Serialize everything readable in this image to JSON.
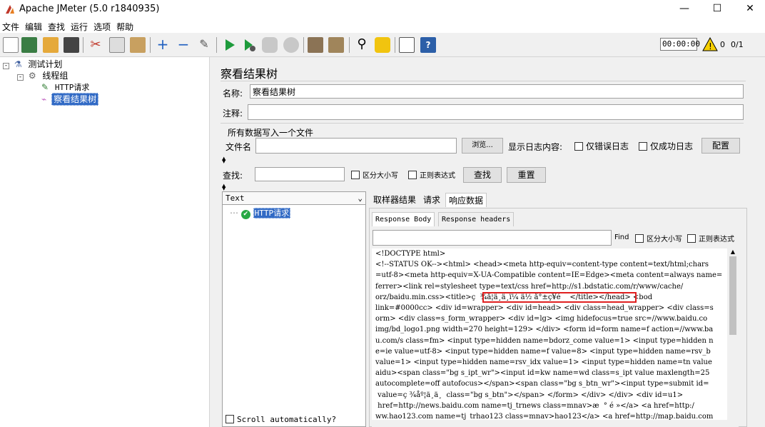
{
  "window": {
    "title": "Apache JMeter (5.0 r1840935)",
    "minimize": "—",
    "maximize": "☐",
    "close": "✕"
  },
  "menu": [
    "文件",
    "编辑",
    "查找",
    "运行",
    "选项",
    "帮助"
  ],
  "toolbar": {
    "icons": [
      "new-icon",
      "templates-icon",
      "open-icon",
      "save-icon",
      "cut-icon",
      "copy-icon",
      "paste-icon",
      "expand-icon",
      "collapse-icon",
      "toggle-icon",
      "start-icon",
      "start-no-pause-icon",
      "stop-icon",
      "shutdown-icon",
      "clear-icon",
      "clear-all-icon",
      "search-icon",
      "reset-search-icon",
      "function-helper-icon",
      "help-icon"
    ],
    "timer": "00:00:00",
    "warning_count": "0",
    "threads": "0/1"
  },
  "tree": {
    "root": "测试计划",
    "thread_group": "线程组",
    "http_request": "HTTP请求",
    "results_tree": "察看结果树"
  },
  "panel": {
    "title": "察看结果树",
    "name_label": "名称:",
    "name_value": "察看结果树",
    "comment_label": "注释:",
    "comment_value": "",
    "write_all_label": "所有数据写入一个文件",
    "filename_label": "文件名",
    "filename_value": "",
    "browse_button": "浏览...",
    "log_content_label": "显示日志内容:",
    "errors_only": "仅错误日志",
    "success_only": "仅成功日志",
    "configure_button": "配置",
    "search_label": "查找:",
    "search_value": "",
    "case_sensitive": "区分大小写",
    "regex": "正则表达式",
    "search_button": "查找",
    "reset_button": "重置"
  },
  "renderer": {
    "selected": "Text",
    "sample_item": "HTTP请求",
    "scroll_auto": "Scroll automatically?"
  },
  "tabs": {
    "sampler_result": "取样器结果",
    "request": "请求",
    "response_data": "响应数据"
  },
  "subtabs": {
    "body": "Response Body",
    "headers": "Response headers"
  },
  "find": {
    "label": "Find",
    "case_sensitive": "区分大小写",
    "regex": "正则表达式",
    "value": ""
  },
  "response_lines": [
    "<!DOCTYPE html>",
    "<!--STATUS OK--><html> <head><meta http-equiv=content-type content=text/html;chars",
    "=utf-8><meta http-equiv=X-UA-Compatible content=IE=Edge><meta content=always name=",
    "ferrer><link rel=stylesheet type=text/css href=http://s1.bdstatic.com/r/www/cache/",
    "orz/baidu.min.css><title>ç  ¾å¦ä¸ä¸ï¼ ä½ å°±ç¥é    </title></head> <bod",
    "link=#0000cc> <div id=wrapper> <div id=head> <div class=head_wrapper> <div class=s",
    "orm> <div class=s_form_wrapper> <div id=lg> <img hidefocus=true src=//www.baidu.co",
    "img/bd_logo1.png width=270 height=129> </div> <form id=form name=f action=//www.ba",
    "u.com/s class=fm> <input type=hidden name=bdorz_come value=1> <input type=hidden n",
    "e=ie value=utf-8> <input type=hidden name=f value=8> <input type=hidden name=rsv_b",
    "value=1> <input type=hidden name=rsv_idx value=1> <input type=hidden name=tn value",
    "aidu><span class=\"bg s_ipt_wr\"><input id=kw name=wd class=s_ipt value maxlength=25",
    "autocomplete=off autofocus></span><span class=\"bg s_btn_wr\"><input type=submit id=",
    " value=ç ¾åº¦ä¸ä¸  class=\"bg s_btn\"></span> </form> </div> </div> <div id=u1>",
    " href=http://news.baidu.com name=tj_trnews class=mnav>æ  ° é »</a> <a href=http:/",
    "ww.hao123.com name=tj_trhao123 class=mnav>hao123</a> <a href=http://map.baidu.com"
  ]
}
